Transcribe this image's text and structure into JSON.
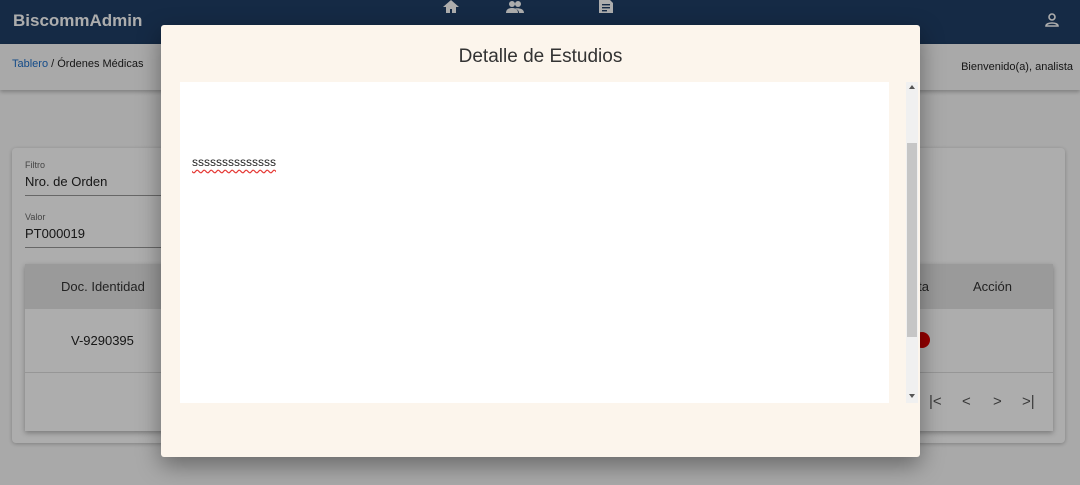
{
  "header": {
    "brand": "BiscommAdmin",
    "nav_icons": [
      "home-icon",
      "people-icon",
      "document-icon"
    ],
    "user_icon": "person-icon",
    "colors": {
      "bar": "#1f3f66",
      "link": "#1e6fc9",
      "alert": "#e00000"
    }
  },
  "breadcrumb": {
    "home": "Tablero",
    "separator": " / ",
    "current": "Órdenes Médicas"
  },
  "welcome": "Bienvenido(a), analista",
  "filters": {
    "filter_label": "Filtro",
    "filter_value": "Nro. de Orden",
    "value_label": "Valor",
    "value_value": "PT000019"
  },
  "table": {
    "headers": {
      "doc": "Doc. Identidad",
      "alert": "Alerta",
      "action": "Acción"
    },
    "rows": [
      {
        "doc": "V-9290395",
        "alert": "red-dot"
      }
    ]
  },
  "pager": {
    "first": "|<",
    "prev": "<",
    "next": ">",
    "last": ">|"
  },
  "modal": {
    "title": "Detalle de Estudios",
    "body": "ssssssssssssss"
  }
}
